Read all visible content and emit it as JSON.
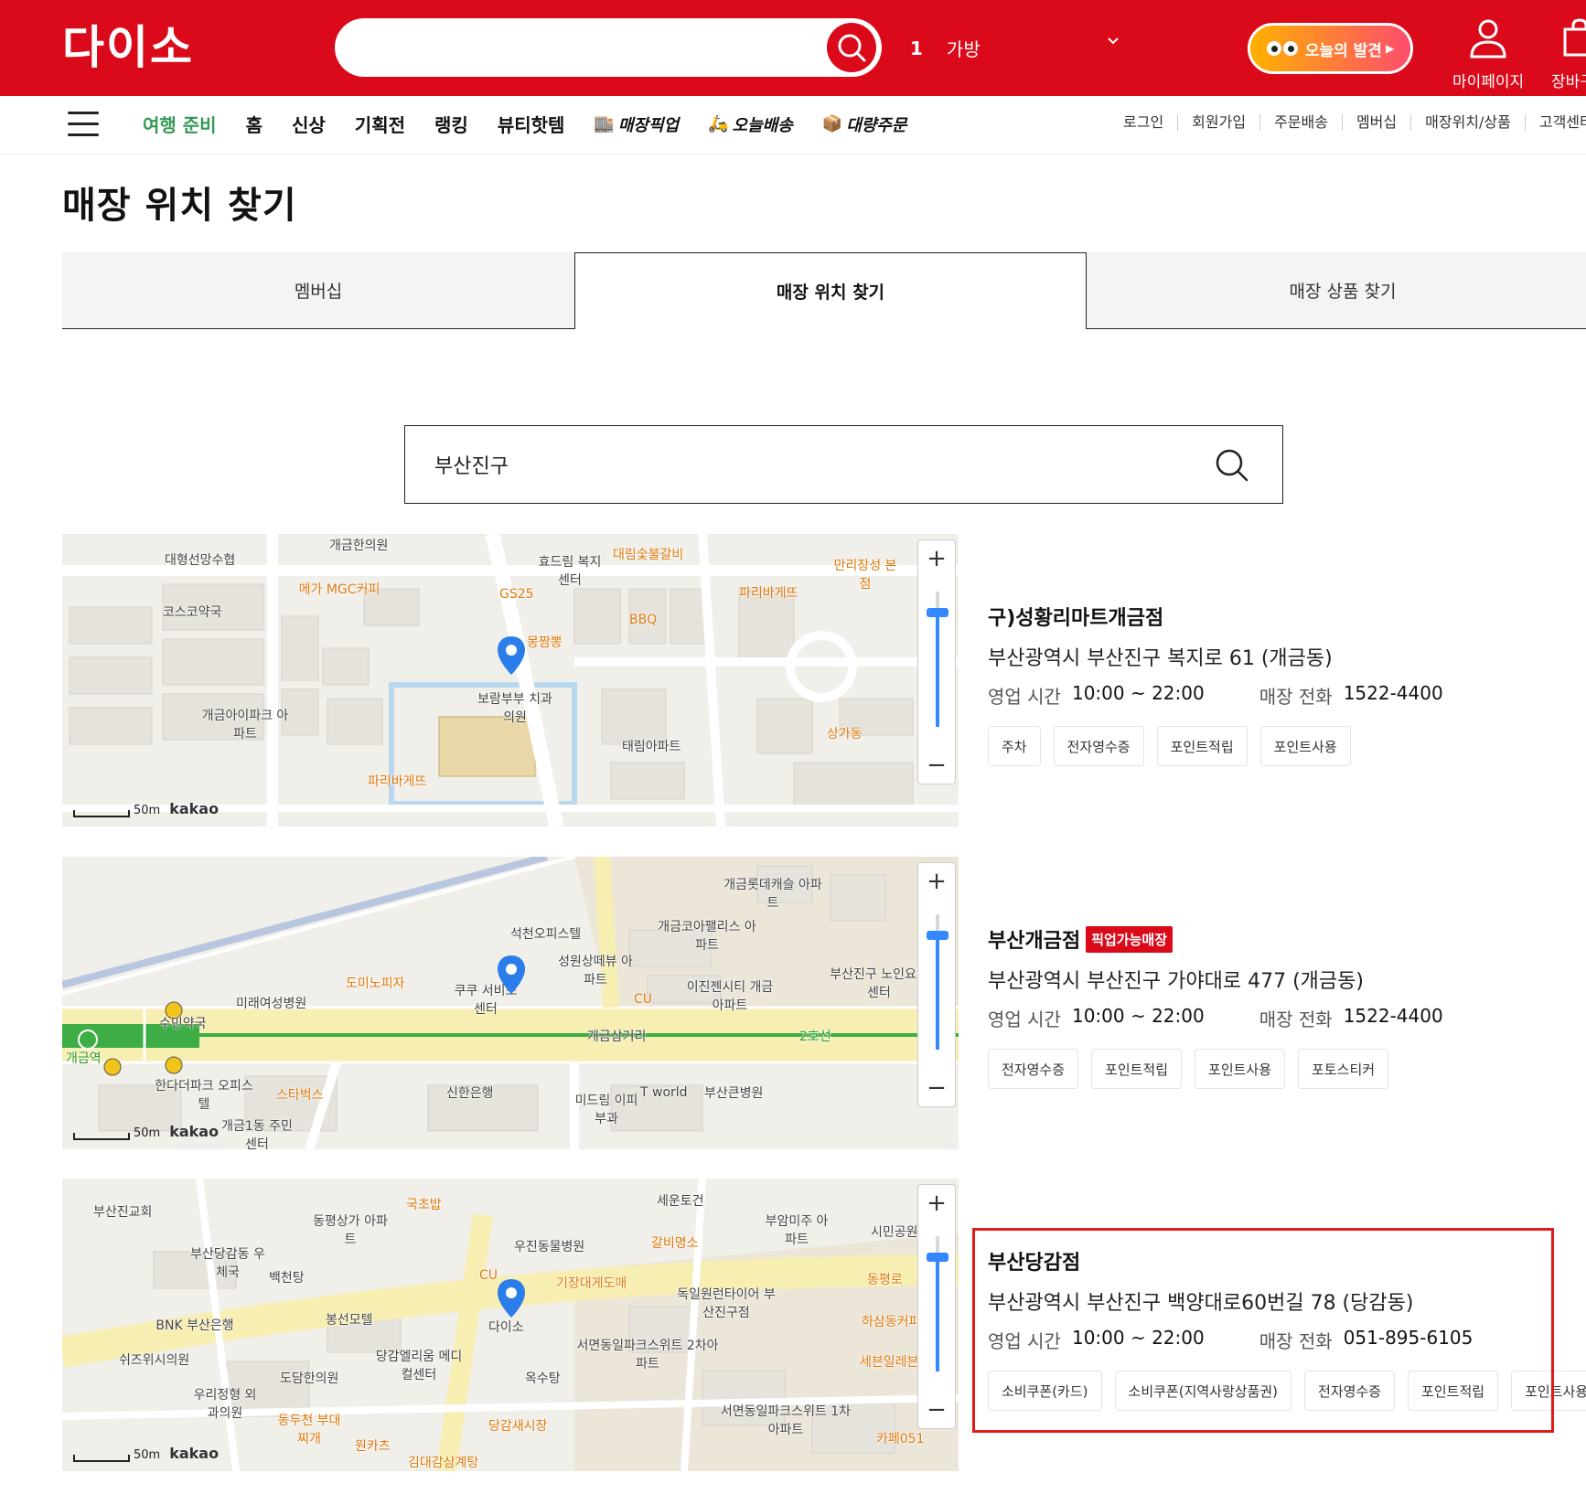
{
  "header": {
    "logo": "다이소",
    "search_placeholder": "",
    "ranking": {
      "rank": "1",
      "keyword": "가방"
    },
    "today_discovery": "오늘의 발견",
    "mypage": "마이페이지",
    "cart": "장바구니"
  },
  "nav": {
    "main": [
      "여행 준비",
      "홈",
      "신상",
      "기획전",
      "랭킹",
      "뷰티핫템"
    ],
    "special": [
      "매장픽업",
      "오늘배송",
      "대량주문"
    ],
    "util": [
      "로그인",
      "회원가입",
      "주문배송",
      "멤버십",
      "매장위치/상품",
      "고객센터"
    ]
  },
  "page": {
    "title": "매장 위치 찾기",
    "tabs": [
      "멤버십",
      "매장 위치 찾기",
      "매장 상품 찾기"
    ],
    "active_tab": "매장 위치 찾기",
    "search_value": "부산진구"
  },
  "labels": {
    "hours": "영업 시간",
    "phone": "매장 전화",
    "pickup_badge": "픽업가능매장"
  },
  "map_common": {
    "scale": "50m",
    "brand": "kakao"
  },
  "stores": [
    {
      "name": "구)성황리마트개금점",
      "address": "부산광역시 부산진구 복지로 61 (개금동)",
      "hours": "10:00 ~ 22:00",
      "phone": "1522-4400",
      "pickup": false,
      "tags": [
        "주차",
        "전자영수증",
        "포인트적립",
        "포인트사용"
      ],
      "map_labels": [
        "대형선망수협",
        "개금한의원",
        "메가 MGC커피",
        "효드림 복지센터",
        "대림숯불갈비",
        "만리장성 본점",
        "코스코약국",
        "GS25",
        "BBQ",
        "파리바게뜨",
        "몽짬뽕",
        "보람부부 치과의원",
        "개금아이파크 아파트",
        "태림아파트",
        "상가동",
        "파리바게뜨"
      ]
    },
    {
      "name": "부산개금점",
      "address": "부산광역시 부산진구 가야대로 477 (개금동)",
      "hours": "10:00 ~ 22:00",
      "phone": "1522-4400",
      "pickup": true,
      "tags": [
        "전자영수증",
        "포인트적립",
        "포인트사용",
        "포토스티커"
      ],
      "map_labels": [
        "개금롯데캐슬 아파트",
        "석천오피스텔",
        "개금코아팰리스 아파트",
        "성원상떼뷰 아파트",
        "도미노피자",
        "미래여성병원",
        "쿠쿠 서비스센터",
        "CU",
        "이진젠시티 개금아파트",
        "부산진구 노인요양센터",
        "수민약국",
        "개금역",
        "개금삼거리",
        "2호선",
        "한다더파크 오피스텔",
        "스타벅스",
        "신한은행",
        "미드림 이피부과",
        "T world",
        "부산큰병원",
        "개금1동 주민센터"
      ]
    },
    {
      "name": "부산당감점",
      "address": "부산광역시 부산진구 백양대로60번길 78 (당감동)",
      "hours": "10:00 ~ 22:00",
      "phone": "051-895-6105",
      "pickup": false,
      "tags": [
        "소비쿠폰(카드)",
        "소비쿠폰(지역사랑상품권)",
        "전자영수증",
        "포인트적립",
        "포인트사용"
      ],
      "map_labels": [
        "부산진교회",
        "국초밥",
        "세운토건",
        "부암미주 아파트",
        "시민공원",
        "동평상가 아파트",
        "우진동물병원",
        "갈비명소",
        "부산당감동 우체국",
        "백천탕",
        "기장대게도매",
        "독일원런타이어 부산진구점",
        "CU",
        "다이소",
        "동평로",
        "BNK 부산은행",
        "봉선모텔",
        "서면동일파크스위트 2차아파트",
        "하삼동커피",
        "쉬즈위시의원",
        "당감엘리움 메디컬센터",
        "도담한의원",
        "옥수탕",
        "세븐일레븐",
        "우리정형 외과의원",
        "동두천 부대찌개",
        "당감새시장",
        "서면동일파크스위트 1차아파트",
        "원카츠",
        "김대감삼계탕",
        "카페051"
      ]
    }
  ],
  "colors": {
    "brand_red": "#da0a1a",
    "pin_blue": "#2b7de9",
    "highlight": "#e21b1b"
  }
}
